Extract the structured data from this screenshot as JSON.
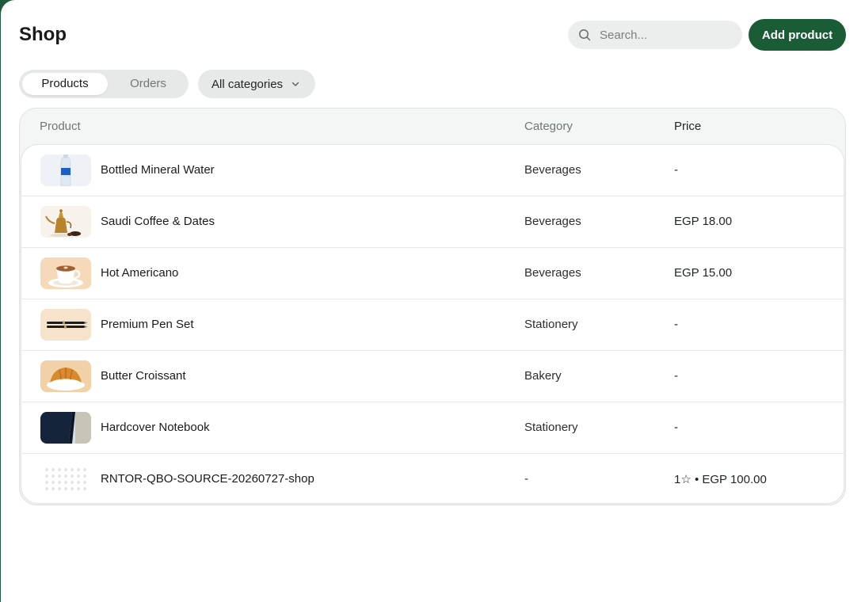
{
  "header": {
    "title": "Shop",
    "search_placeholder": "Search...",
    "add_button": "Add product"
  },
  "tabs": [
    {
      "label": "Products",
      "active": true
    },
    {
      "label": "Orders",
      "active": false
    }
  ],
  "category_filter": {
    "selected": "All categories"
  },
  "table": {
    "columns": [
      "Product",
      "Category",
      "Price"
    ],
    "rows": [
      {
        "name": "Bottled Mineral Water",
        "category": "Beverages",
        "price": "-",
        "thumb_icon": "water-bottle-icon"
      },
      {
        "name": "Saudi Coffee & Dates",
        "category": "Beverages",
        "price": "EGP 18.00",
        "thumb_icon": "coffee-pot-icon"
      },
      {
        "name": "Hot Americano",
        "category": "Beverages",
        "price": "EGP 15.00",
        "thumb_icon": "coffee-cup-icon"
      },
      {
        "name": "Premium Pen Set",
        "category": "Stationery",
        "price": "-",
        "thumb_icon": "pens-icon"
      },
      {
        "name": "Butter Croissant",
        "category": "Bakery",
        "price": "-",
        "thumb_icon": "croissant-icon"
      },
      {
        "name": "Hardcover Notebook",
        "category": "Stationery",
        "price": "-",
        "thumb_icon": "notebook-icon"
      },
      {
        "name": "RNTOR-QBO-SOURCE-20260727-shop",
        "category": "-",
        "price": "1☆ • EGP 100.00",
        "thumb_icon": "placeholder-pattern-icon"
      }
    ]
  },
  "colors": {
    "accent": "#1a5c36",
    "page_bg": "#ffffff",
    "chip_bg": "#e6e9e7"
  }
}
